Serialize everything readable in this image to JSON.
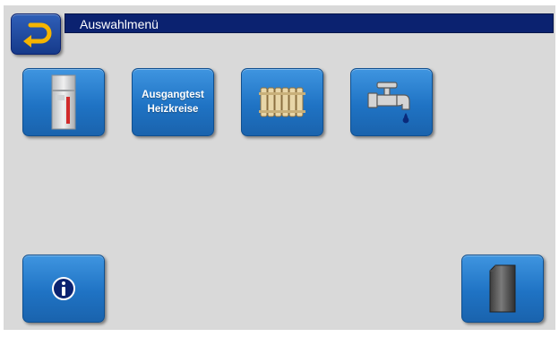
{
  "header": {
    "title": "Auswahlmenü"
  },
  "back_button": {
    "icon": "back-arrow-icon",
    "icon_color": "#f5b400"
  },
  "menu": {
    "boiler": {
      "icon": "boiler-icon"
    },
    "output_test": {
      "line1": "Ausgangtest",
      "line2": "Heizkreise"
    },
    "heating_circuit": {
      "icon": "radiator-icon"
    },
    "hot_water": {
      "icon": "water-tap-icon"
    }
  },
  "bottom": {
    "info": {
      "icon": "info-icon"
    },
    "storage": {
      "icon": "storage-tank-icon"
    }
  },
  "colors": {
    "title_bar": "#0b2270",
    "button": "#1f73c4",
    "background": "#d9d9d9"
  }
}
